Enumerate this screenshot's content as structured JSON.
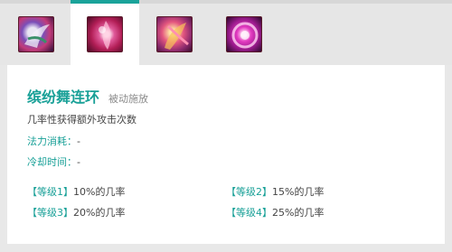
{
  "tabs": [
    {
      "name": "tab-skill-1",
      "icon": "skill-1-icon",
      "active": false
    },
    {
      "name": "tab-skill-2",
      "icon": "skill-2-icon",
      "active": true
    },
    {
      "name": "tab-skill-3",
      "icon": "skill-3-icon",
      "active": false
    },
    {
      "name": "tab-skill-4",
      "icon": "skill-4-icon",
      "active": false
    }
  ],
  "skill": {
    "name": "缤纷舞连环",
    "type": "被动施放",
    "description": "几率性获得额外攻击次数",
    "mana_label": "法力消耗：",
    "mana_value": "-",
    "cooldown_label": "冷却时间：",
    "cooldown_value": "-"
  },
  "levels": [
    {
      "tag": "【等级1】",
      "text": "10%的几率"
    },
    {
      "tag": "【等级2】",
      "text": "15%的几率"
    },
    {
      "tag": "【等级3】",
      "text": "20%的几率"
    },
    {
      "tag": "【等级4】",
      "text": "25%的几率"
    }
  ],
  "colors": {
    "accent": "#1aa39a",
    "text": "#444444",
    "muted": "#8a8a8a"
  }
}
